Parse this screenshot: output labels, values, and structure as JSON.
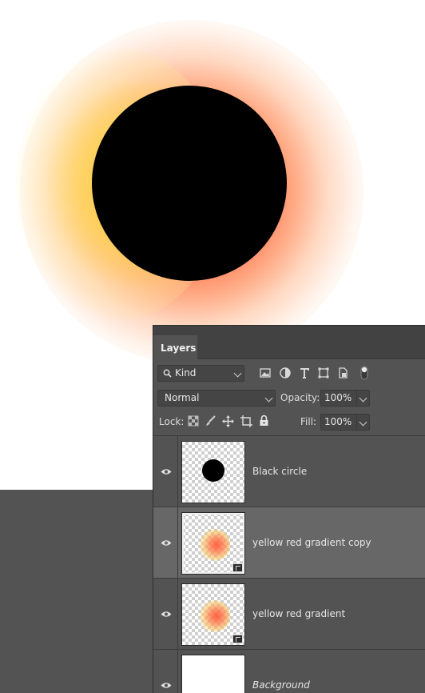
{
  "panel": {
    "tab_label": "Layers"
  },
  "filter": {
    "kind_label": "Kind",
    "icons": [
      "image-filter-icon",
      "adjustment-filter-icon",
      "type-filter-icon",
      "shape-filter-icon",
      "smart-object-filter-icon",
      "filter-toggle-icon"
    ]
  },
  "blend": {
    "mode": "Normal",
    "opacity_label": "Opacity:",
    "opacity_value": "100%"
  },
  "lock": {
    "lock_label": "Lock:",
    "fill_label": "Fill:",
    "fill_value": "100%",
    "icons": [
      "lock-transparent-icon",
      "lock-paint-icon",
      "lock-move-icon",
      "lock-artboard-icon",
      "lock-all-icon"
    ]
  },
  "layers": [
    {
      "name": "Black circle",
      "visible": true,
      "selected": false,
      "thumbnail": "black-dot",
      "smart_object": false
    },
    {
      "name": "yellow red gradient copy",
      "visible": true,
      "selected": true,
      "thumbnail": "gradient",
      "smart_object": true
    },
    {
      "name": "yellow red gradient",
      "visible": true,
      "selected": false,
      "thumbnail": "gradient",
      "smart_object": true
    },
    {
      "name": "Background",
      "visible": true,
      "selected": false,
      "thumbnail": "white",
      "smart_object": false
    }
  ],
  "colors": {
    "panel_bg": "#535353",
    "selected_row": "#676767",
    "circle": "#000000",
    "glow_red": "#ff7850",
    "glow_yellow": "#ffd73c"
  }
}
